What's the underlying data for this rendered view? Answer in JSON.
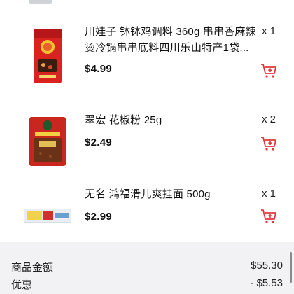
{
  "items": [
    {
      "name": "川娃子 钵钵鸡调料 360g  串串香麻辣烫冷锅串串底料四川乐山特产1袋...",
      "qty": "x 1",
      "price": "$4.99",
      "thumb_icon": "seasoning-bag-red"
    },
    {
      "name": "翠宏 花椒粉 25g",
      "qty": "x 2",
      "price": "$2.49",
      "thumb_icon": "spice-bag-red"
    },
    {
      "name": "无名 鸿福滑儿爽挂面 500g",
      "qty": "x 1",
      "price": "$2.99",
      "thumb_icon": "noodle-pack"
    }
  ],
  "summary": {
    "subtotal_label": "商品金额",
    "subtotal_value": "$55.30",
    "discount_label": "优惠",
    "discount_value": "- $5.53"
  },
  "colors": {
    "accent": "#e2383b",
    "summary_bg": "#f2f2f4"
  }
}
